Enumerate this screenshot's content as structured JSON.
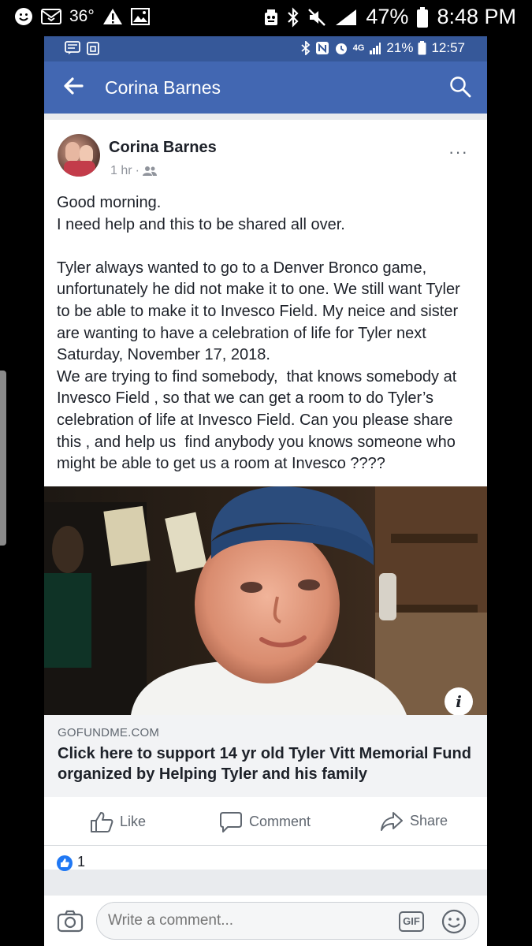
{
  "outer_status": {
    "temperature": "36°",
    "battery_percent": "47%",
    "time": "8:48 PM"
  },
  "inner_status": {
    "network": "4G",
    "battery_percent": "21%",
    "time": "12:57"
  },
  "header": {
    "title": "Corina Barnes",
    "icons": [
      "back-arrow-icon",
      "search-icon"
    ]
  },
  "post": {
    "author": "Corina Barnes",
    "time_ago": "1 hr",
    "separator": "·",
    "audience_icon": "friends-icon",
    "more_label": "···",
    "text": "Good morning.\nI need help and this to be shared all over.\n\nTyler always wanted to go to a Denver Bronco game, unfortunately he did not make it to one. We still want Tyler to be able to make it to Invesco Field. My neice and sister  are wanting to have a celebration of life for Tyler next Saturday, November 17, 2018.\nWe are trying to find somebody,  that knows somebody at Invesco Field , so that we can get a room to do Tyler’s celebration of life at Invesco Field. Can you please share this , and help us  find anybody you knows someone who might be able to get us a room at Invesco ????",
    "info_label": "i",
    "link": {
      "domain": "GOFUNDME.COM",
      "title": "Click here to support 14 yr old Tyler Vitt Memorial Fund organized by Helping Tyler and his family"
    }
  },
  "actions": {
    "like": "Like",
    "comment": "Comment",
    "share": "Share"
  },
  "reactions": {
    "count": "1"
  },
  "composer": {
    "placeholder": "Write a comment...",
    "gif_label": "GIF"
  },
  "colors": {
    "facebook_blue": "#4267b2",
    "status_blue": "#365899",
    "like_blue": "#2078f4"
  }
}
